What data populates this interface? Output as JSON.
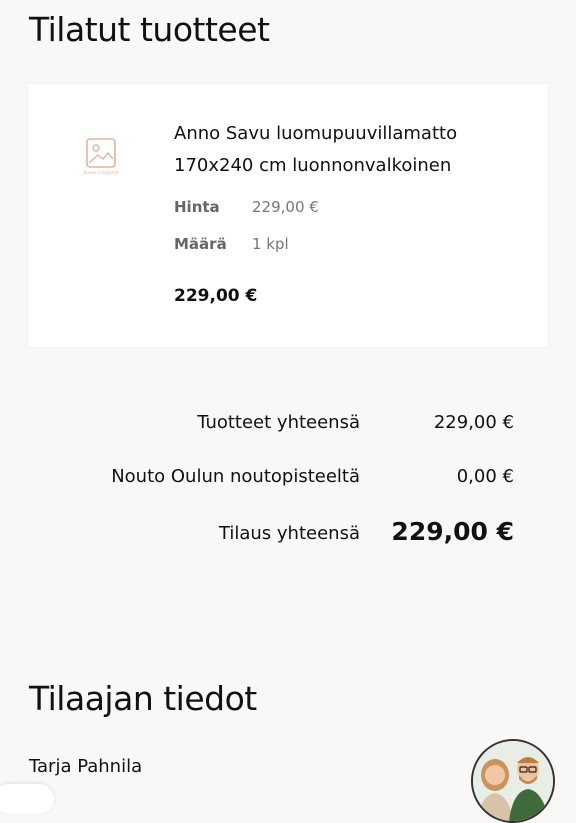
{
  "ordered": {
    "title": "Tilatut tuotteet",
    "item": {
      "name": "Anno Savu luomupuuvillamatto 170x240 cm luonnonvalkoinen",
      "image_caption": "Kuvaa ei löytynyt",
      "price_label": "Hinta",
      "price_value": "229,00 €",
      "qty_label": "Määrä",
      "qty_value": "1 kpl",
      "line_total": "229,00 €"
    }
  },
  "summary": {
    "rows": [
      {
        "label": "Tuotteet yhteensä",
        "value": "229,00 €"
      },
      {
        "label": "Nouto Oulun noutopisteeltä",
        "value": "0,00 €"
      },
      {
        "label": "Tilaus yhteensä",
        "value": "229,00 €"
      }
    ]
  },
  "customer": {
    "title": "Tilaajan tiedot",
    "name": "Tarja Pahnila"
  },
  "colors": {
    "background": "#f9f8f7",
    "card": "#ffffff",
    "placeholder_icon": "#e2b49a"
  },
  "icons": {
    "placeholder": "image-placeholder-icon",
    "avatar": "support-avatar"
  }
}
